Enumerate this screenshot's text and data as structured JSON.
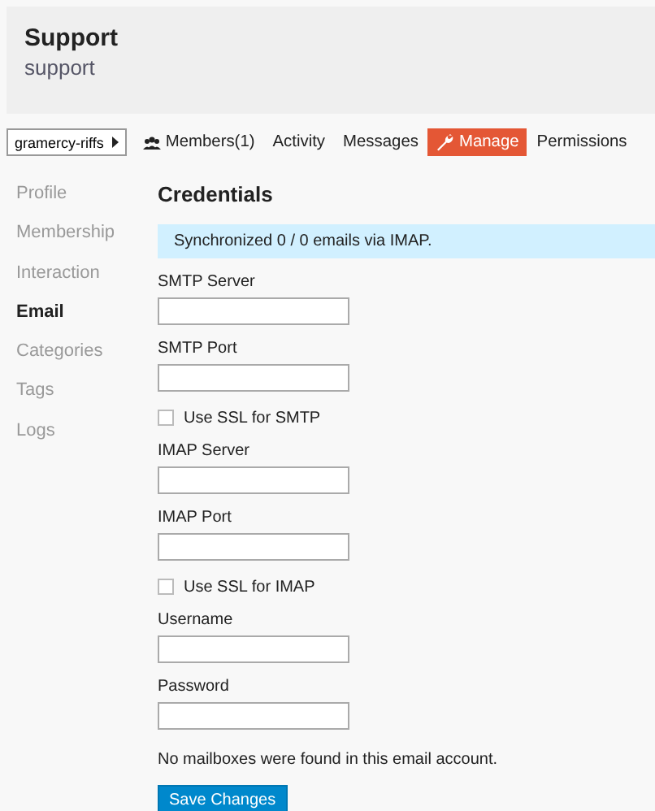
{
  "header": {
    "title": "Support",
    "subtitle": "support"
  },
  "category_button": {
    "label": "gramercy-riffs"
  },
  "tabs": [
    {
      "label": "Members(1)",
      "kind": "people",
      "selected": false
    },
    {
      "label": "Activity",
      "kind": "plain",
      "selected": false
    },
    {
      "label": "Messages",
      "kind": "plain",
      "selected": false
    },
    {
      "label": "Manage",
      "kind": "wrench",
      "selected": true
    },
    {
      "label": "Permissions",
      "kind": "plain",
      "selected": false
    }
  ],
  "sidebar": {
    "items": [
      {
        "label": "Profile",
        "selected": false
      },
      {
        "label": "Membership",
        "selected": false
      },
      {
        "label": "Interaction",
        "selected": false
      },
      {
        "label": "Email",
        "selected": true
      },
      {
        "label": "Categories",
        "selected": false
      },
      {
        "label": "Tags",
        "selected": false
      },
      {
        "label": "Logs",
        "selected": false
      }
    ]
  },
  "section_title": "Credentials",
  "notice": "Synchronized 0 / 0 emails via IMAP.",
  "fields": [
    {
      "kind": "text",
      "label": "SMTP Server"
    },
    {
      "kind": "text",
      "label": "SMTP Port"
    },
    {
      "kind": "checkbox",
      "label": "Use SSL for SMTP",
      "checked": false
    },
    {
      "kind": "text",
      "label": "IMAP Server"
    },
    {
      "kind": "text",
      "label": "IMAP Port"
    },
    {
      "kind": "checkbox",
      "label": "Use SSL for IMAP",
      "checked": false
    },
    {
      "kind": "text",
      "label": "Username"
    },
    {
      "kind": "text",
      "label": "Password"
    }
  ],
  "status_message": "No mailboxes were found in this email account.",
  "save_button": {
    "label": "Save Changes"
  }
}
